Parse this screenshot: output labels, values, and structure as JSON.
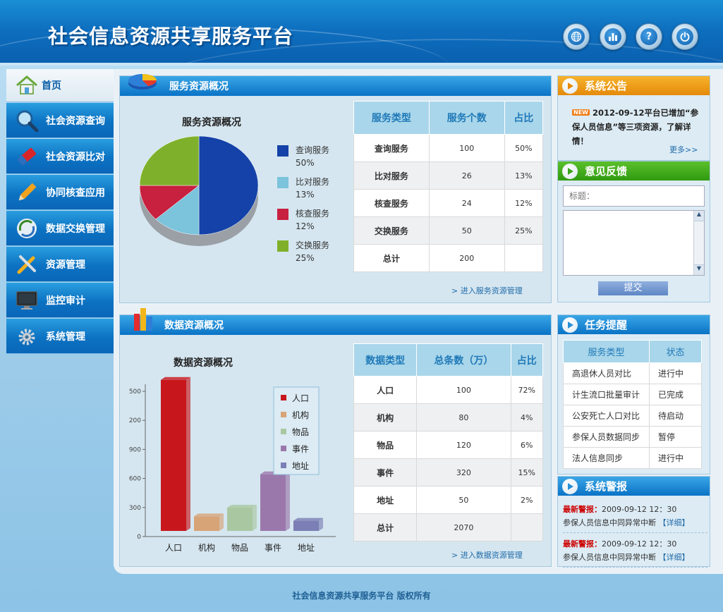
{
  "app": {
    "title": "社会信息资源共享服务平台",
    "footer": "社会信息资源共享服务平台  版权所有"
  },
  "header_buttons": [
    {
      "name": "globe-button",
      "icon": "globe-icon"
    },
    {
      "name": "chart-button",
      "icon": "bar-chart-icon"
    },
    {
      "name": "help-button",
      "icon": "question-icon",
      "glyph": "?"
    },
    {
      "name": "power-button",
      "icon": "power-icon"
    }
  ],
  "sidebar": {
    "items": [
      {
        "label": "首页",
        "icon": "home-icon"
      },
      {
        "label": "社会资源查询",
        "icon": "search-icon"
      },
      {
        "label": "社会资源比对",
        "icon": "eraser-icon"
      },
      {
        "label": "协同核查应用",
        "icon": "pencil-icon"
      },
      {
        "label": "数据交换管理",
        "icon": "exchange-icon"
      },
      {
        "label": "资源管理",
        "icon": "tools-icon"
      },
      {
        "label": "监控审计",
        "icon": "monitor-icon"
      },
      {
        "label": "系统管理",
        "icon": "gear-icon"
      }
    ]
  },
  "service": {
    "title": "服务资源概况",
    "more": "> 进入服务资源管理",
    "headers": [
      "服务类型",
      "服务个数",
      "占比"
    ],
    "rows": [
      [
        "查询服务",
        "100",
        "50%"
      ],
      [
        "比对服务",
        "26",
        "13%"
      ],
      [
        "核查服务",
        "24",
        "12%"
      ],
      [
        "交换服务",
        "50",
        "25%"
      ],
      [
        "总计",
        "200",
        ""
      ]
    ]
  },
  "data_panel": {
    "title": "数据资源概况",
    "more": "> 进入数据资源管理",
    "headers": [
      "数据类型",
      "总条数（万）",
      "占比"
    ],
    "rows": [
      [
        "人口",
        "100",
        "72%"
      ],
      [
        "机构",
        "80",
        "4%"
      ],
      [
        "物品",
        "120",
        "6%"
      ],
      [
        "事件",
        "320",
        "15%"
      ],
      [
        "地址",
        "50",
        "2%"
      ],
      [
        "总计",
        "2070",
        ""
      ]
    ]
  },
  "chart_data": [
    {
      "type": "pie",
      "title": "服务资源概况",
      "categories": [
        "查询服务",
        "比对服务",
        "核查服务",
        "交换服务"
      ],
      "values": [
        50,
        13,
        12,
        25
      ],
      "labels": [
        "50%",
        "13%",
        "12%",
        "25%"
      ],
      "colors": [
        "#1442a8",
        "#7cc3dc",
        "#c8203f",
        "#7fb02c"
      ],
      "legend": "right"
    },
    {
      "type": "bar",
      "title": "数据资源概况",
      "categories": [
        "人口",
        "机构",
        "物品",
        "事件",
        "地址"
      ],
      "values": [
        520,
        50,
        80,
        195,
        35
      ],
      "colors": [
        "#c7171c",
        "#d7a478",
        "#a9c8a2",
        "#9b78ac",
        "#7b7fb5"
      ],
      "yticks": [
        "0",
        "300",
        "600",
        "900",
        "200",
        "500"
      ],
      "ylim": [
        0,
        500
      ],
      "legend": "top-right"
    }
  ],
  "notice": {
    "title": "系统公告",
    "badge": "NEW",
    "text": "2012-09-12平台已增加“参保人员信息”等三项资源，了解详情！",
    "more": "更多>>"
  },
  "feedback": {
    "title": "意见反馈",
    "placeholder": "标题：",
    "submit": "提交"
  },
  "tasks": {
    "title": "任务提醒",
    "headers": [
      "服务类型",
      "状态"
    ],
    "rows": [
      [
        "高退休人员对比",
        "进行中"
      ],
      [
        "计生流口批量审计",
        "已完成"
      ],
      [
        "公安死亡人口对比",
        "待启动"
      ],
      [
        "参保人员数据同步",
        "暂停"
      ],
      [
        "法人信息同步",
        "进行中"
      ]
    ]
  },
  "alerts": {
    "title": "系统警报",
    "items": [
      {
        "tag": "最新警报：",
        "time": "2009-09-12  12：30",
        "msg": "参保人员信息中同异常中断",
        "link": "【详细】"
      },
      {
        "tag": "最新警报：",
        "time": "2009-09-12  12：30",
        "msg": "参保人员信息中同异常中断",
        "link": "【详细】"
      }
    ]
  }
}
